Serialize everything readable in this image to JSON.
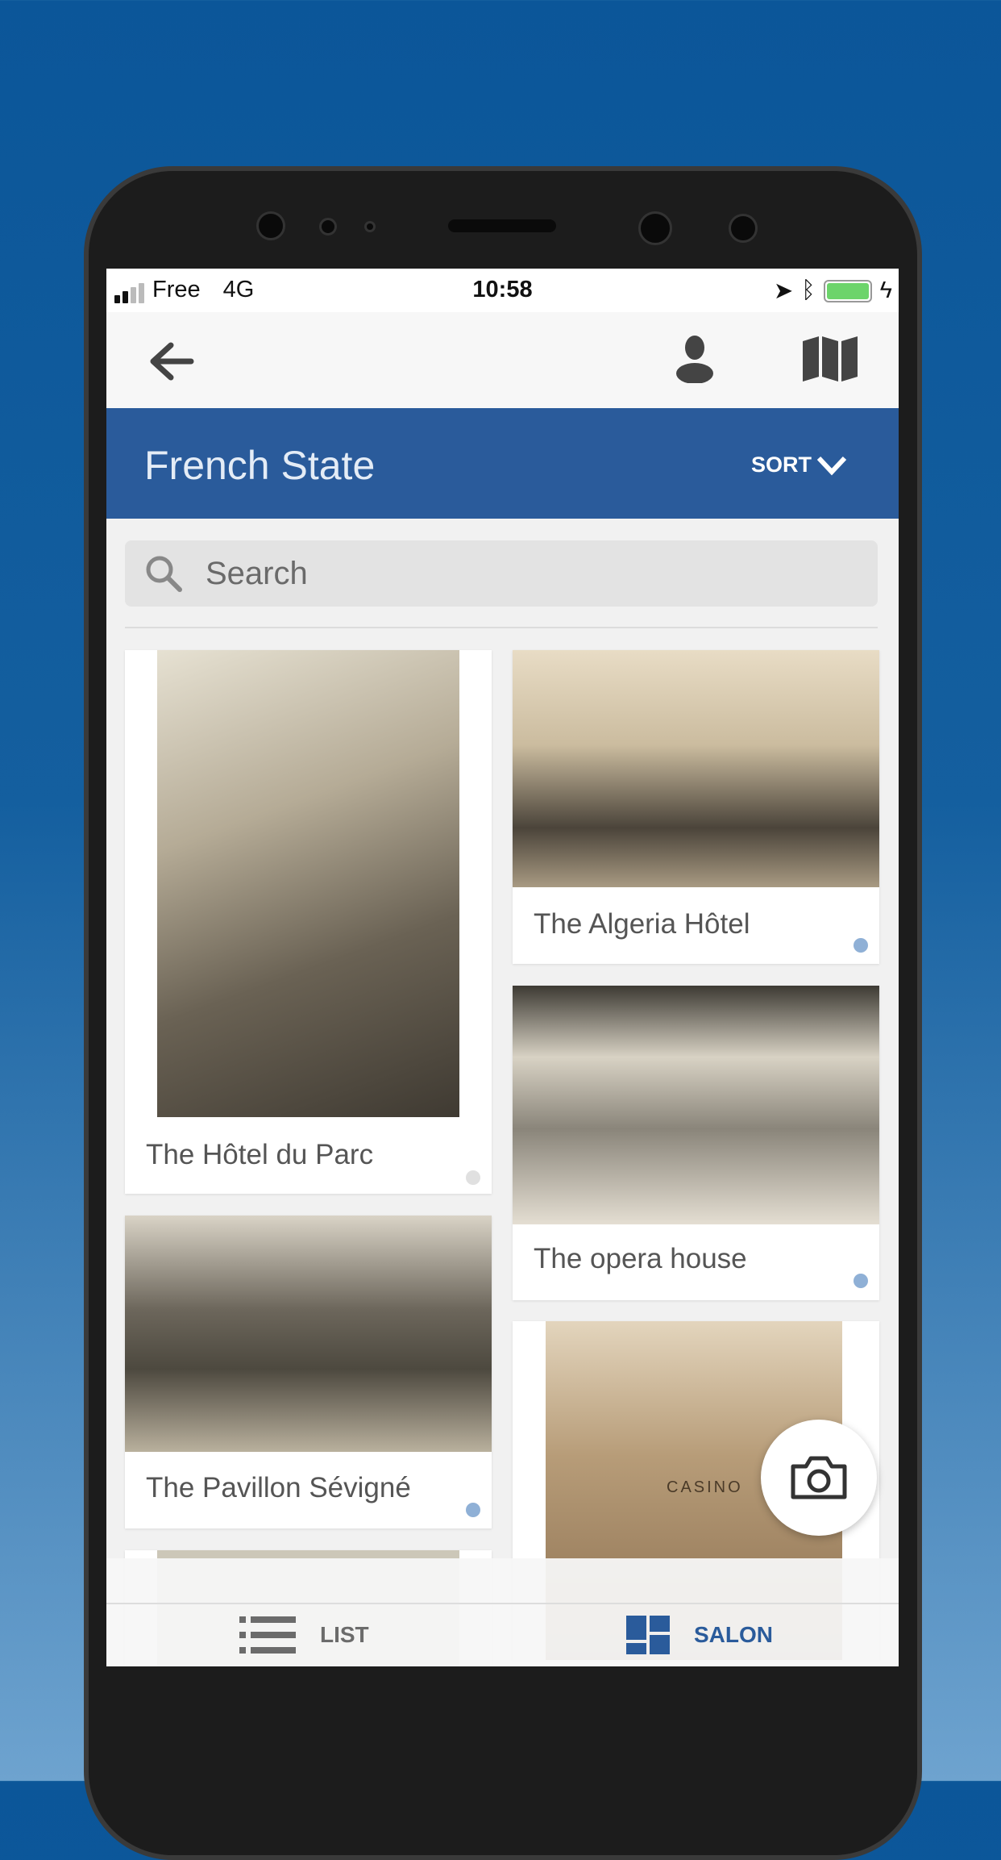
{
  "status_bar": {
    "carrier": "Free",
    "network": "4G",
    "time": "10:58",
    "battery_percent": 100
  },
  "nav": {
    "back_icon": "arrow-left-icon",
    "profile_icon": "user-icon",
    "map_icon": "map-icon"
  },
  "header": {
    "title": "French State",
    "sort_label": "SORT"
  },
  "search": {
    "placeholder": "Search",
    "value": ""
  },
  "items": [
    {
      "caption": "The Hôtel du Parc",
      "dot_color": "#e0e0e0"
    },
    {
      "caption": "The Algeria Hôtel",
      "dot_color": "#8fb0d6"
    },
    {
      "caption": "The opera house",
      "dot_color": "#8fb0d6"
    },
    {
      "caption": "The Pavillon Sévigné",
      "dot_color": "#8fb0d6"
    }
  ],
  "casino_sign": "CASINO",
  "bottom_nav": {
    "list_label": "LIST",
    "salon_label": "SALON",
    "active": "SALON"
  },
  "colors": {
    "accent": "#2a5b9b",
    "inactive": "#6b6b6b"
  }
}
